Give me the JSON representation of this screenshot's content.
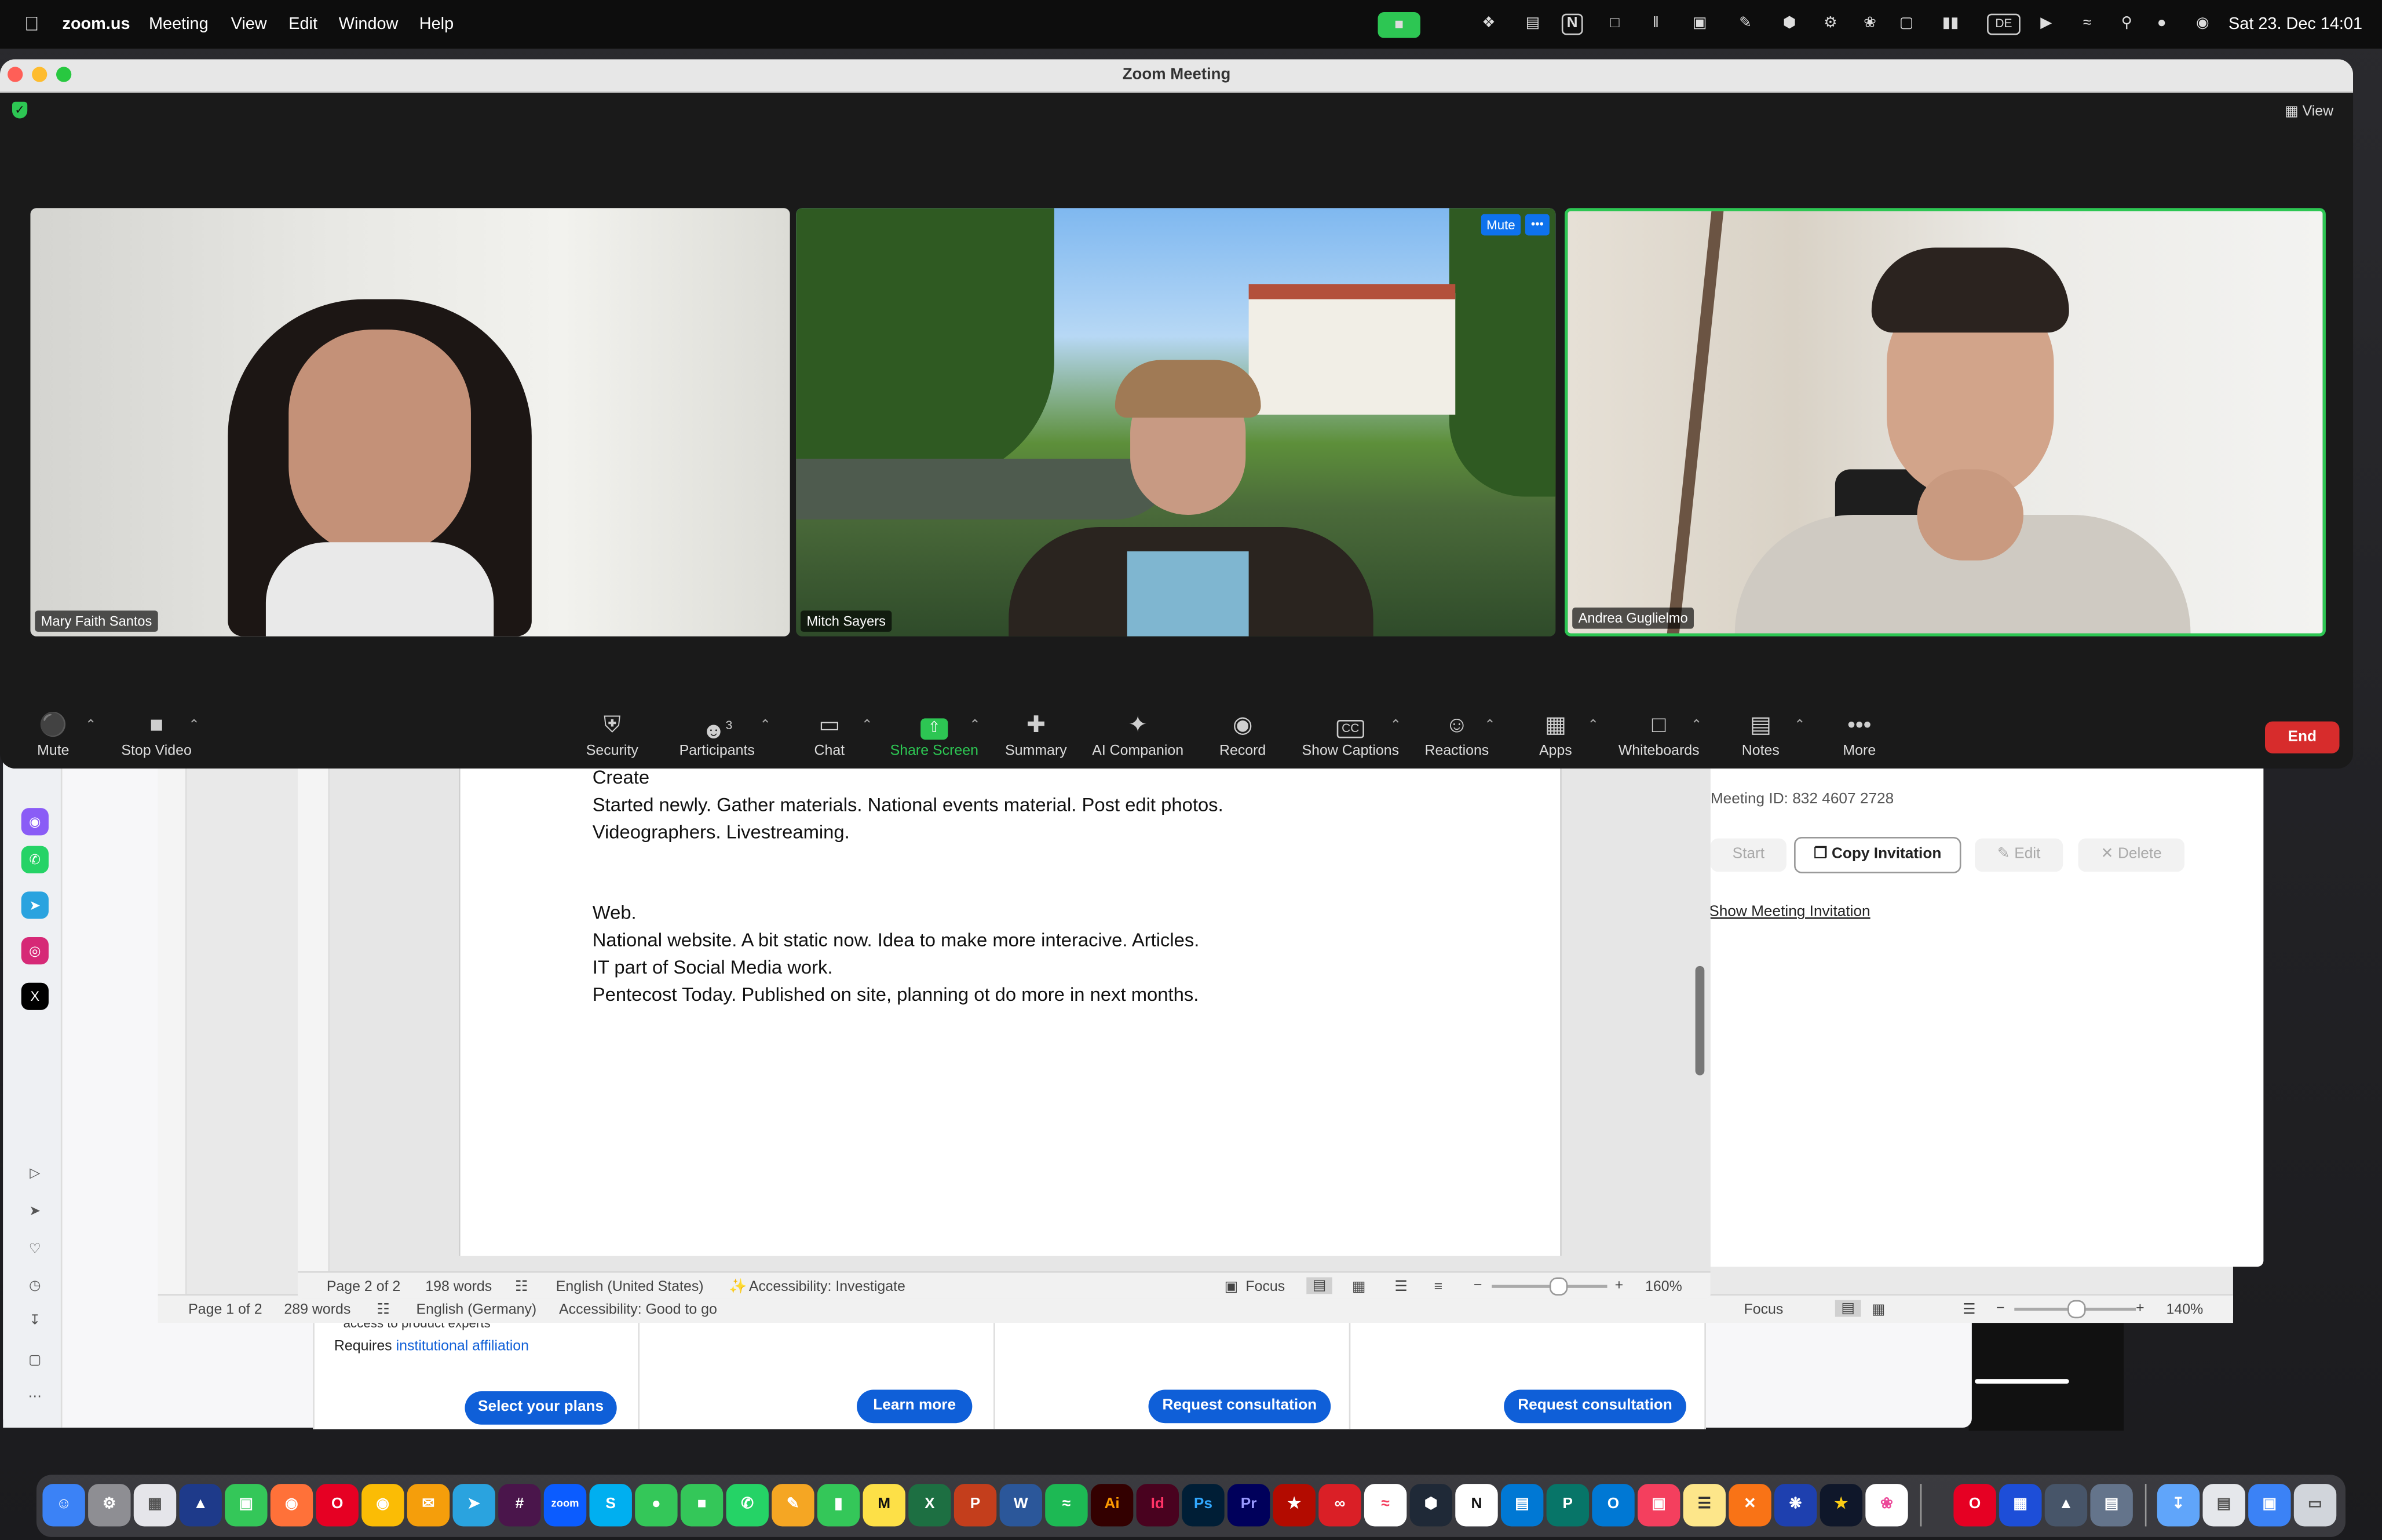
{
  "menubar": {
    "app": "zoom.us",
    "items": [
      "Meeting",
      "View",
      "Edit",
      "Window",
      "Help"
    ],
    "input_source": "DE",
    "clock": "Sat 23. Dec  14:01"
  },
  "zoom": {
    "window_title": "Zoom Meeting",
    "view_label": "View",
    "participants": [
      {
        "name": "Mary Faith Santos"
      },
      {
        "name": "Mitch Sayers",
        "mute_label": "Mute",
        "more_label": "•••"
      },
      {
        "name": "Andrea Guglielmo"
      }
    ],
    "toolbar": {
      "mute": "Mute",
      "stop_video": "Stop Video",
      "security": "Security",
      "participants": "Participants",
      "participants_count": "3",
      "chat": "Chat",
      "share_screen": "Share Screen",
      "summary": "Summary",
      "ai_companion": "AI Companion",
      "record": "Record",
      "show_captions": "Show Captions",
      "reactions": "Reactions",
      "apps": "Apps",
      "whiteboards": "Whiteboards",
      "notes": "Notes",
      "more": "More",
      "end": "End"
    },
    "accent_green": "#2dc653",
    "end_red": "#d72c2c"
  },
  "word_front": {
    "lines": [
      "Create",
      "Started newly.  Gather materials.  National events material. Post edit photos.",
      "Videographers. Livestreaming.",
      "Web.",
      "National website.  A bit static now.  Idea to make more interacive.  Articles.",
      "IT part of Social Media work.",
      "Pentecost Today.  Published on site, planning ot do more in next months."
    ],
    "status": {
      "page": "Page 2 of 2",
      "words": "198 words",
      "language": "English (United States)",
      "accessibility": "Accessibility: Investigate",
      "focus": "Focus",
      "zoom": "160%"
    }
  },
  "word_back": {
    "status": {
      "page": "Page 1 of 2",
      "words": "289 words",
      "language": "English (Germany)",
      "accessibility": "Accessibility: Good to go",
      "focus": "Focus",
      "zoom": "140%"
    }
  },
  "zoom_meeting_panel": {
    "meeting_id": "Meeting ID: 832 4607 2728",
    "start": "Start",
    "copy_invitation": "Copy Invitation",
    "edit": "Edit",
    "delete": "Delete",
    "show_invitation": "Show Meeting Invitation"
  },
  "browser_page": {
    "access_text": "access to product experts",
    "requires_text": "Requires",
    "affiliation_link": "institutional affiliation",
    "buttons": [
      "Select your plans",
      "Learn more",
      "Request consultation",
      "Request consultation"
    ]
  },
  "dock_labels": {
    "zoom": "zoom",
    "skype": "S",
    "excel": "X",
    "powerpoint": "P",
    "word": "W",
    "illustrator": "Ai",
    "indesign": "Id",
    "photoshop": "Ps",
    "premiere": "Pr",
    "notion": "N",
    "publisher": "P",
    "outlook": "O"
  }
}
